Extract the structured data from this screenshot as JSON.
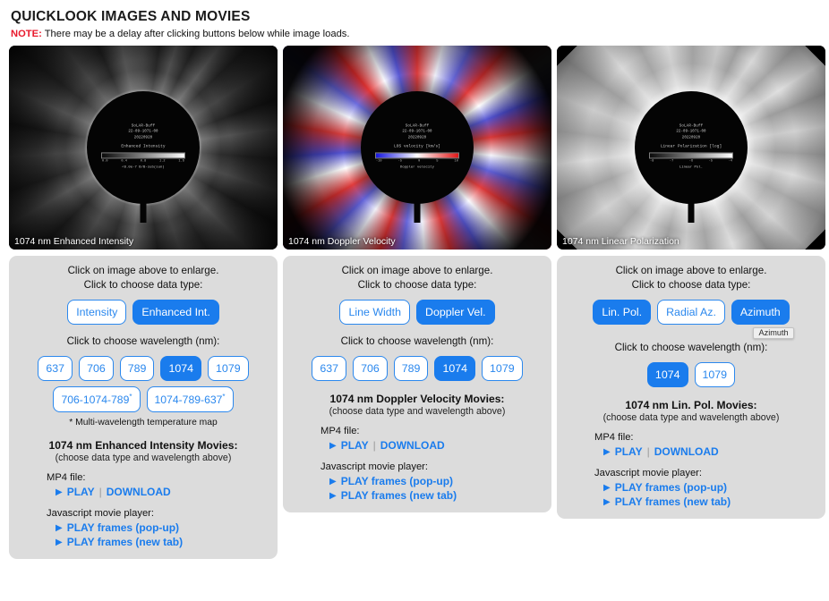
{
  "header": {
    "title": "QUICKLOOK IMAGES AND MOVIES",
    "note_flag": "NOTE:",
    "note_text": "There may be a delay after clicking buttons below while image loads."
  },
  "common": {
    "enlarge_hint": "Click on image above to enlarge.",
    "datatype_hint": "Click to choose data type:",
    "wavelength_hint": "Click to choose wavelength (nm):",
    "movies_sub": "(choose data type and wavelength above)",
    "mp4_label": "MP4 file:",
    "js_label": "Javascript movie player:",
    "play": "PLAY",
    "download": "DOWNLOAD",
    "separator": "|",
    "play_popup": "PLAY frames (pop-up)",
    "play_newtab": "PLAY frames (new tab)",
    "play_icon": "play-triangle-icon"
  },
  "colors": {
    "accent_blue": "#1a7ced",
    "button_border": "#2b88ee",
    "panel_gray": "#dcdcdc",
    "note_red": "#e8192c",
    "link_blue": "#1a7ced"
  },
  "panels": [
    {
      "id": "enhanced-intensity",
      "image": {
        "caption": "1074 nm Enhanced Intensity",
        "overlay_title": "SoLAR-Buff",
        "overlay_time": "22-09-1071-00",
        "overlay_date": "20220920",
        "colorbar_label": "Enhanced Intensity",
        "colorbar_type": "grayscale",
        "colorbar_ticks": [
          "0.0",
          "0.4",
          "0.8",
          "1.2",
          "1.6"
        ],
        "colorbar_foot": "<8.0e-7 B/B-sub(sun)"
      },
      "data_types": [
        {
          "label": "Intensity",
          "active": false
        },
        {
          "label": "Enhanced Int.",
          "active": true
        }
      ],
      "wavelengths": [
        {
          "label": "637",
          "active": false
        },
        {
          "label": "706",
          "active": false
        },
        {
          "label": "789",
          "active": false
        },
        {
          "label": "1074",
          "active": true
        },
        {
          "label": "1079",
          "active": false
        }
      ],
      "multi_wavelengths": [
        {
          "label": "706-1074-789",
          "star": "*",
          "active": false
        },
        {
          "label": "1074-789-637",
          "star": "*",
          "active": false
        }
      ],
      "footnote": "* Multi-wavelength temperature map",
      "movies_title": "1074 nm Enhanced Intensity Movies:"
    },
    {
      "id": "doppler-velocity",
      "image": {
        "caption": "1074 nm Doppler Velocity",
        "overlay_title": "SoLAR-Buff",
        "overlay_time": "22-09-1071-00",
        "overlay_date": "20220920",
        "colorbar_label": "LOS velocity [km/s]",
        "colorbar_type": "diverging",
        "colorbar_ticks": [
          "-10",
          "-5",
          "0",
          "5",
          "10"
        ],
        "colorbar_foot": "Doppler velocity"
      },
      "data_types": [
        {
          "label": "Line Width",
          "active": false
        },
        {
          "label": "Doppler Vel.",
          "active": true
        }
      ],
      "wavelengths": [
        {
          "label": "637",
          "active": false
        },
        {
          "label": "706",
          "active": false
        },
        {
          "label": "789",
          "active": false
        },
        {
          "label": "1074",
          "active": true
        },
        {
          "label": "1079",
          "active": false
        }
      ],
      "multi_wavelengths": [],
      "footnote": "",
      "movies_title": "1074 nm Doppler Velocity Movies:"
    },
    {
      "id": "linear-polarization",
      "image": {
        "caption": "1074 nm Linear Polarization",
        "overlay_title": "SoLAR-Buff",
        "overlay_time": "22-09-1071-00",
        "overlay_date": "20220920",
        "colorbar_label": "Linear Polarization [log]",
        "colorbar_type": "grayscale",
        "colorbar_ticks": [
          "-8",
          "-7",
          "-6",
          "-5",
          "-4"
        ],
        "colorbar_foot": "Linear Pol."
      },
      "data_types": [
        {
          "label": "Lin. Pol.",
          "active": true
        },
        {
          "label": "Radial Az.",
          "active": false
        },
        {
          "label": "Azimuth",
          "active": true,
          "tooltip": "Azimuth"
        }
      ],
      "wavelengths": [
        {
          "label": "1074",
          "active": true
        },
        {
          "label": "1079",
          "active": false
        }
      ],
      "multi_wavelengths": [],
      "footnote": "",
      "movies_title": "1074 nm Lin. Pol. Movies:"
    }
  ]
}
